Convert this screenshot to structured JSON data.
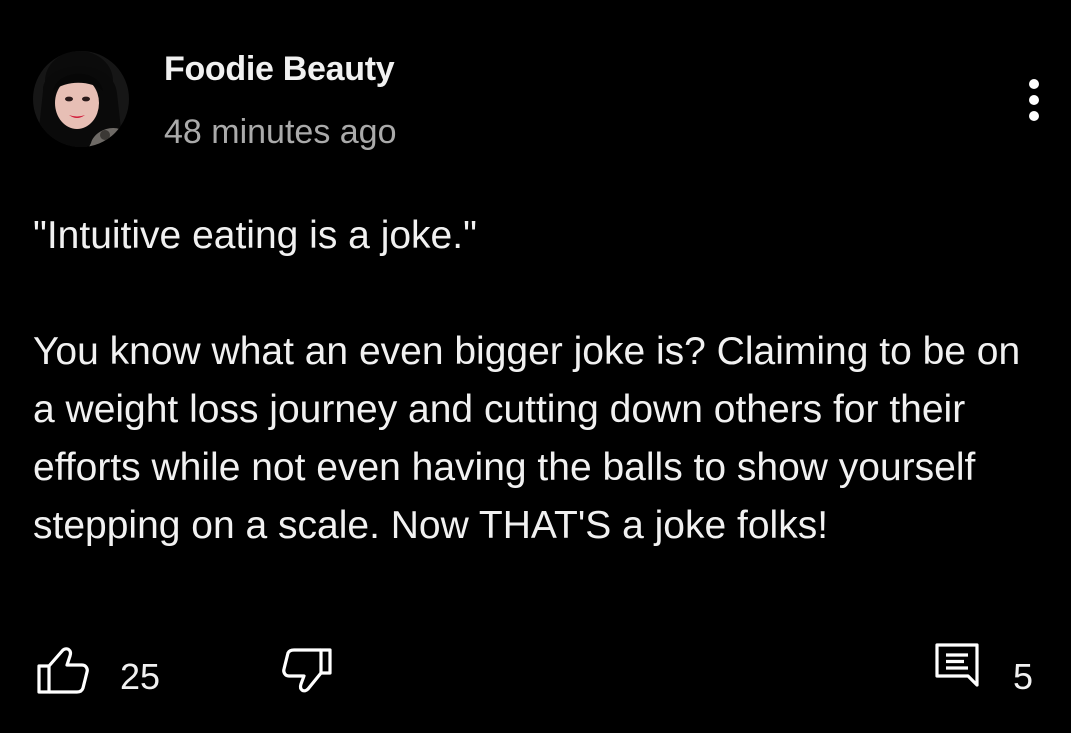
{
  "comment": {
    "author": "Foodie Beauty",
    "timestamp": "48 minutes ago",
    "quote": "\"Intuitive eating is a joke.\"",
    "body": "You know what an even bigger joke is? Claiming to be on a weight loss journey and cutting down others for their efforts while not even having the balls to show yourself stepping on a scale. Now THAT'S a joke folks!"
  },
  "actions": {
    "like_count": "25",
    "reply_count": "5"
  },
  "icons": {
    "like": "thumbs-up-icon",
    "dislike": "thumbs-down-icon",
    "reply": "reply-icon",
    "menu": "more-vertical-icon"
  },
  "colors": {
    "background": "#000000",
    "text": "#f1f1f1",
    "secondary_text": "#aaaaaa"
  }
}
